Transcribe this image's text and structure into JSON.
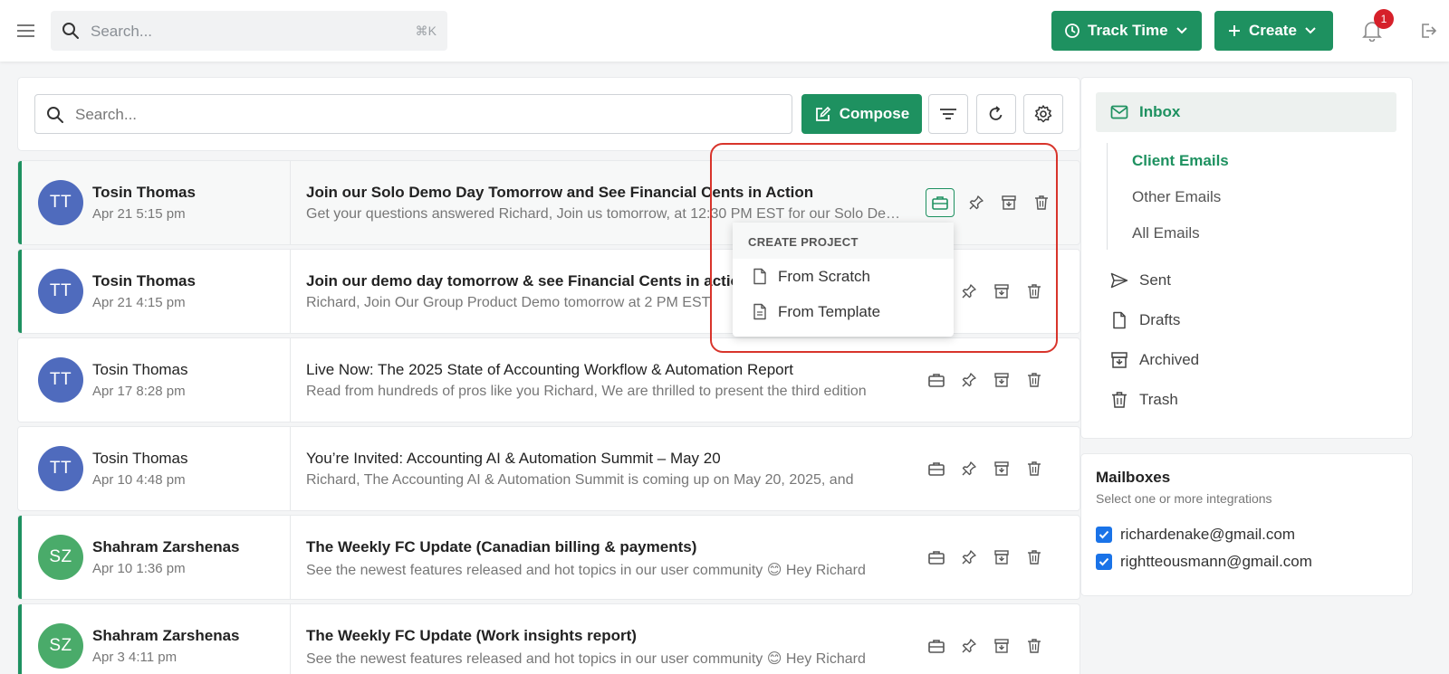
{
  "topbar": {
    "search_placeholder": "Search...",
    "search_shortcut": "⌘K",
    "track_time_label": "Track Time",
    "create_label": "Create",
    "notification_count": "1"
  },
  "toolbar": {
    "search_placeholder": "Search...",
    "compose_label": "Compose"
  },
  "emails": [
    {
      "initials": "TT",
      "sender": "Tosin Thomas",
      "date": "Apr 21 5:15 pm",
      "subject": "Join our Solo Demo Day Tomorrow and See Financial Cents in Action",
      "preview": "Get your questions answered Richard, Join us tomorrow, at 12:30 PM EST for our Solo Demo Day",
      "unread": true
    },
    {
      "initials": "TT",
      "sender": "Tosin Thomas",
      "date": "Apr 21 4:15 pm",
      "subject": "Join our demo day tomorrow & see Financial Cents in action",
      "preview": "Richard, Join Our Group Product Demo tomorrow at 2 PM EST",
      "unread": true
    },
    {
      "initials": "TT",
      "sender": "Tosin Thomas",
      "date": "Apr 17 8:28 pm",
      "subject": "Live Now: The 2025 State of Accounting Workflow & Automation Report",
      "preview": "Read from hundreds of pros like you Richard, We are thrilled to present the third edition",
      "unread": false
    },
    {
      "initials": "TT",
      "sender": "Tosin Thomas",
      "date": "Apr 10 4:48 pm",
      "subject": "You’re Invited: Accounting AI & Automation Summit – May 20",
      "preview": "Richard, The Accounting AI & Automation Summit is coming up on May 20, 2025, and",
      "unread": false
    },
    {
      "initials": "SZ",
      "sender": "Shahram Zarshenas",
      "date": "Apr 10 1:36 pm",
      "subject": "The Weekly FC Update (Canadian billing & payments)",
      "preview": "See the newest features released and hot topics in our user community 😊 Hey Richard",
      "unread": true
    },
    {
      "initials": "SZ",
      "sender": "Shahram Zarshenas",
      "date": "Apr 3 4:11 pm",
      "subject": "The Weekly FC Update (Work insights report)",
      "preview": "See the newest features released and hot topics in our user community 😊 Hey Richard",
      "unread": true
    }
  ],
  "dropdown": {
    "header": "CREATE PROJECT",
    "items": [
      "From Scratch",
      "From Template"
    ]
  },
  "sidebar": {
    "inbox_label": "Inbox",
    "sub_items": [
      "Client Emails",
      "Other Emails",
      "All Emails"
    ],
    "nav_items": [
      "Sent",
      "Drafts",
      "Archived",
      "Trash"
    ]
  },
  "mailboxes": {
    "title": "Mailboxes",
    "subtitle": "Select one or more integrations",
    "accounts": [
      "richardenake@gmail.com",
      "rightteousmann@gmail.com"
    ]
  },
  "colors": {
    "brand_green": "#1e9160",
    "avatar_blue": "#4f6bbd",
    "avatar_green": "#4aab6a",
    "highlight_red": "#d8342b",
    "checkbox_blue": "#1a73e8"
  }
}
